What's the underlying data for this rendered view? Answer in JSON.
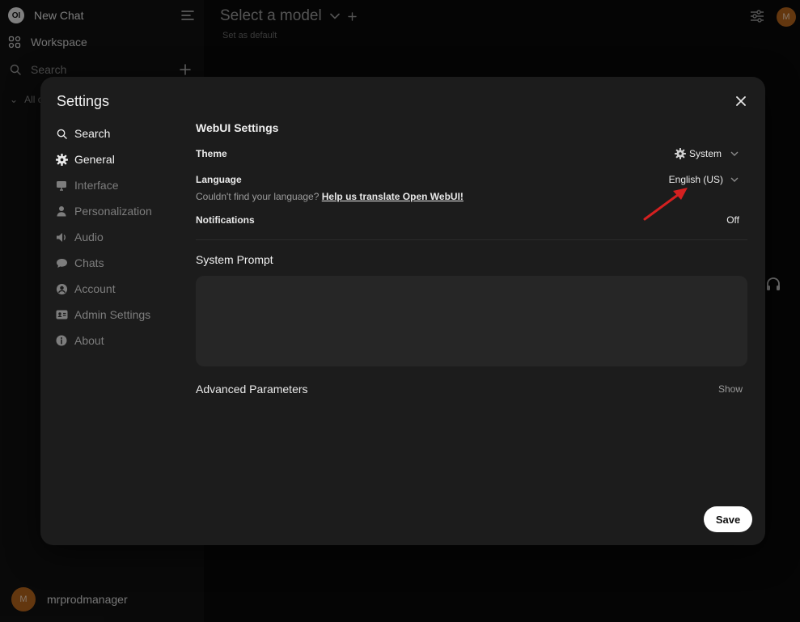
{
  "sidebar": {
    "new_chat": "New Chat",
    "workspace": "Workspace",
    "search": "Search",
    "all_chats_partial": "All c",
    "user_name": "mrprodmanager",
    "avatar_initial": "M"
  },
  "header": {
    "model_select": "Select a model",
    "set_default": "Set as default",
    "avatar_initial": "M"
  },
  "modal": {
    "title": "Settings",
    "nav": [
      {
        "label": "Search",
        "icon": "search-icon"
      },
      {
        "label": "General",
        "icon": "gear-icon",
        "active": true
      },
      {
        "label": "Interface",
        "icon": "monitor-icon"
      },
      {
        "label": "Personalization",
        "icon": "user-icon"
      },
      {
        "label": "Audio",
        "icon": "speaker-icon"
      },
      {
        "label": "Chats",
        "icon": "chat-bubble-icon"
      },
      {
        "label": "Account",
        "icon": "account-circle-icon"
      },
      {
        "label": "Admin Settings",
        "icon": "id-card-icon"
      },
      {
        "label": "About",
        "icon": "info-icon"
      }
    ],
    "webui_settings": "WebUI Settings",
    "theme_label": "Theme",
    "theme_value": "System",
    "language_label": "Language",
    "language_value": "English (US)",
    "language_help": "Couldn't find your language?",
    "language_link": "Help us translate Open WebUI!",
    "notifications_label": "Notifications",
    "notifications_value": "Off",
    "system_prompt": "System Prompt",
    "advanced": "Advanced Parameters",
    "advanced_toggle": "Show",
    "save": "Save"
  },
  "colors": {
    "background": "#0b0b0b",
    "modal": "#1c1c1c",
    "annotation_arrow": "#d42020"
  }
}
